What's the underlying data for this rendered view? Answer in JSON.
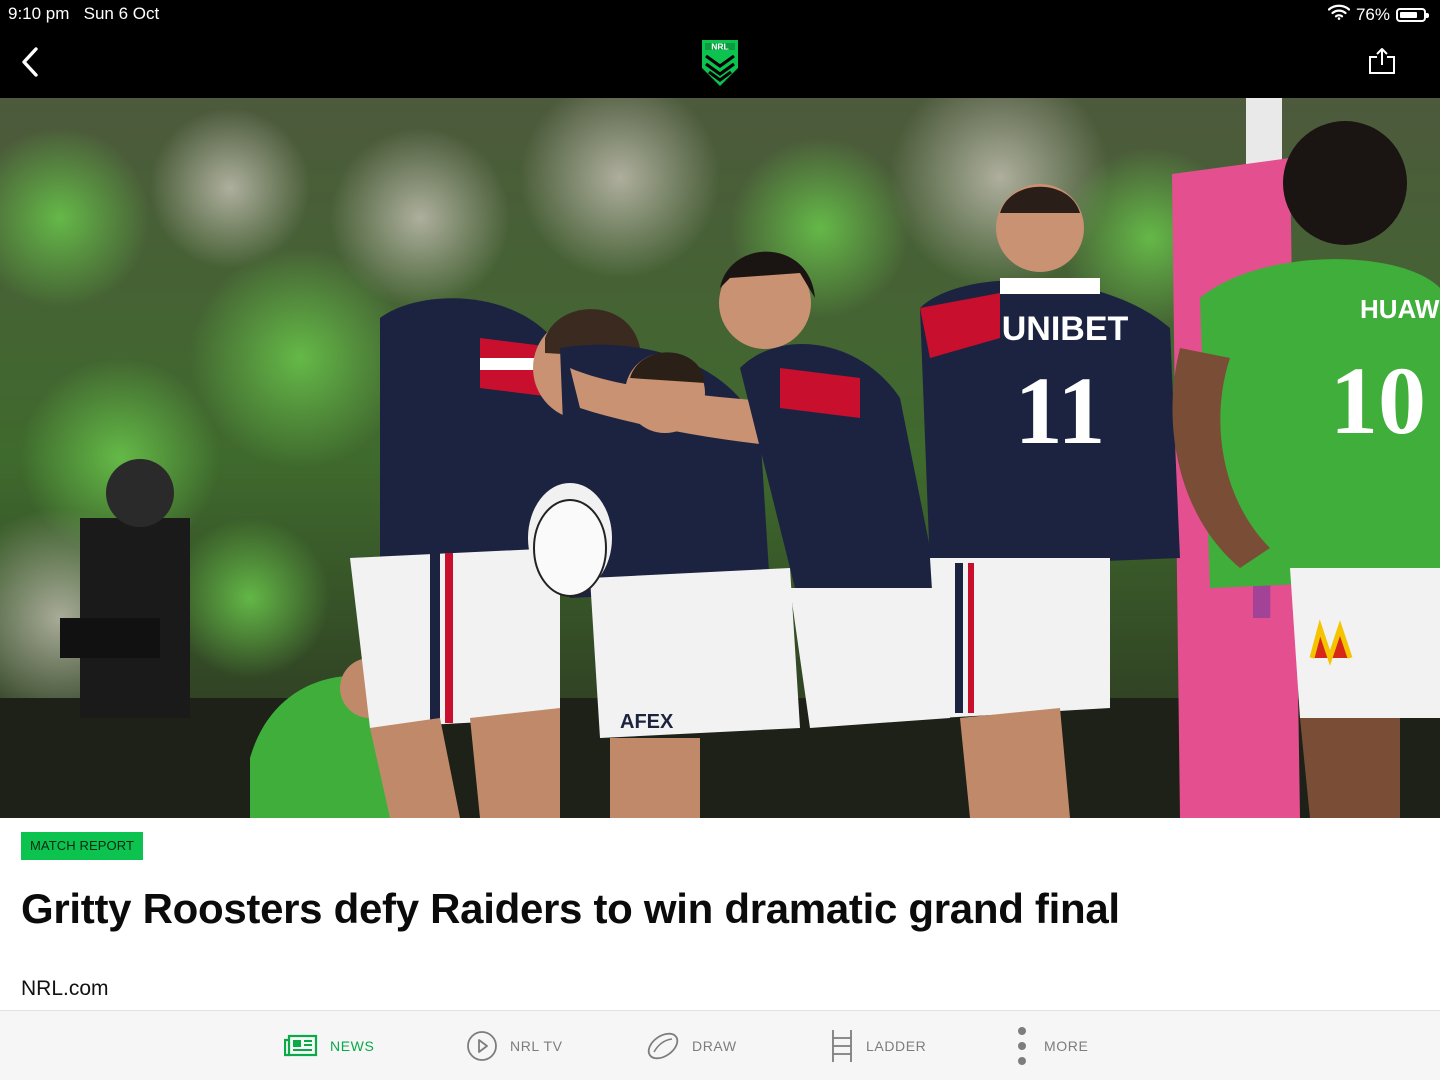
{
  "status_bar": {
    "time": "9:10 pm",
    "date": "Sun 6 Oct",
    "battery": "76%",
    "battery_level": 0.76
  },
  "nav": {
    "back_icon": "chevron-left-icon",
    "share_icon": "share-icon",
    "logo_text": "NRL"
  },
  "article": {
    "tag": "MATCH REPORT",
    "headline": "Gritty Roosters defy Raiders to win dramatic grand final",
    "source": "NRL.com",
    "image": {
      "jersey_sponsor": "UNIBET",
      "jersey_number": "11",
      "raider_sponsor": "HUAW",
      "raider_number": "10",
      "shorts_sponsor": "AFEX"
    }
  },
  "tabs": [
    {
      "label": "NEWS",
      "icon": "newspaper-icon",
      "active": true
    },
    {
      "label": "NRL TV",
      "icon": "play-circle-icon",
      "active": false
    },
    {
      "label": "DRAW",
      "icon": "football-icon",
      "active": false
    },
    {
      "label": "LADDER",
      "icon": "ladder-icon",
      "active": false
    },
    {
      "label": "MORE",
      "icon": "more-vertical-icon",
      "active": false
    }
  ],
  "colors": {
    "accent_green": "#0dc34f",
    "active_tab": "#0aa94a",
    "topbar": "#000000",
    "roosters_navy": "#1c2340",
    "raiders_green": "#3fae3a"
  }
}
